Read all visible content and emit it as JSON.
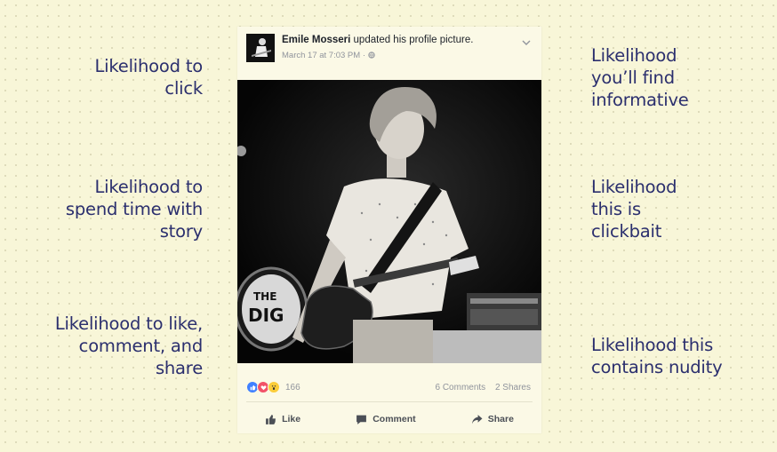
{
  "left_labels": [
    "Likelihood to\nclick",
    "Likelihood to\nspend time with\nstory",
    "Likelihood to like,\ncomment, and\nshare"
  ],
  "right_labels": [
    "Likelihood\nyou’ll find\ninformative",
    "Likelihood\nthis is\nclickbait",
    "Likelihood this\ncontains nudity"
  ],
  "post": {
    "author": "Emile Mosseri",
    "action": " updated his profile picture.",
    "meta": "March 17 at 7:03 PM · ",
    "photo_text": "THE\nDIG",
    "reaction_count": "166",
    "comments": "6 Comments",
    "shares": "2 Shares",
    "actions": {
      "like": "Like",
      "comment": "Comment",
      "share": "Share"
    }
  },
  "colors": {
    "label_text": "#2b2f6e",
    "background": "#f8f6d8",
    "card": "#fbf9e6"
  },
  "icons": [
    "chevron-down-icon",
    "globe-icon",
    "like-icon",
    "comment-icon",
    "share-icon",
    "like-reaction-icon",
    "love-reaction-icon",
    "wow-reaction-icon"
  ]
}
